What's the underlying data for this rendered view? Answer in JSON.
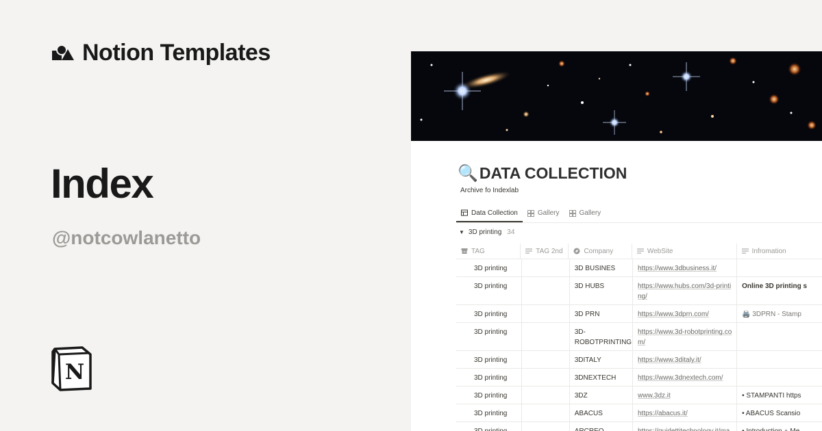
{
  "brand": {
    "name": "Notion Templates",
    "icon": "notion-shapes-icon"
  },
  "page": {
    "title": "Index",
    "author": "@notcowlanetto"
  },
  "notion_logo": {
    "letter": "N",
    "icon": "notion-logo-icon"
  },
  "database": {
    "title": "DATA COLLECTION",
    "title_icon": "magnifying-glass-icon",
    "description": "Archive fo Indexlab",
    "tabs": [
      {
        "label": "Data Collection",
        "icon": "table-icon",
        "active": true
      },
      {
        "label": "Gallery",
        "icon": "gallery-icon",
        "active": false
      },
      {
        "label": "Gallery",
        "icon": "gallery-icon",
        "active": false
      }
    ],
    "group": {
      "label": "3D printing",
      "count": "34"
    },
    "columns": [
      {
        "label": "TAG",
        "icon": "archive-icon"
      },
      {
        "label": "TAG 2nd",
        "icon": "text-lines-icon"
      },
      {
        "label": "Company",
        "icon": "compass-icon"
      },
      {
        "label": "WebSite",
        "icon": "text-lines-icon"
      },
      {
        "label": "Infromation",
        "icon": "text-lines-icon"
      }
    ],
    "rows": [
      {
        "tag": "3D printing",
        "tag2": "",
        "company": "3D BUSINES",
        "website": "https://www.3dbusiness.it/",
        "info": ""
      },
      {
        "tag": "3D printing",
        "tag2": "",
        "company": "3D HUBS",
        "website": "https://www.hubs.com/3d-printing/",
        "info": "Online 3D printing s"
      },
      {
        "tag": "3D printing",
        "tag2": "",
        "company": "3D PRN",
        "website": "https://www.3dprn.com/",
        "info": "🖨️ 3DPRN - Stamp"
      },
      {
        "tag": "3D printing",
        "tag2": "",
        "company": "3D-ROBOTPRINTING",
        "website": "https://www.3d-robotprinting.com/",
        "info": ""
      },
      {
        "tag": "3D printing",
        "tag2": "",
        "company": "3DITALY",
        "website": "https://www.3ditaly.it/",
        "info": ""
      },
      {
        "tag": "3D printing",
        "tag2": "",
        "company": "3DNEXTECH",
        "website": "https://www.3dnextech.com/",
        "info": ""
      },
      {
        "tag": "3D printing",
        "tag2": "",
        "company": "3DZ",
        "website": "www.3dz.it",
        "info": "• STAMPANTI https"
      },
      {
        "tag": "3D printing",
        "tag2": "",
        "company": "ABACUS",
        "website": "https://abacus.it/",
        "info": "• ABACUS Scansio"
      },
      {
        "tag": "3D printing",
        "tag2": "",
        "company": "ARCREO",
        "website": "https://guidettitechnology.it/manifattura-additiva-arcreo/",
        "info": "• Introduction ∘ Me"
      }
    ]
  },
  "colors": {
    "background": "#f4f3f1",
    "text": "#191919",
    "muted": "#9b9a97",
    "panel": "#ffffff",
    "cover": "#05070d"
  }
}
